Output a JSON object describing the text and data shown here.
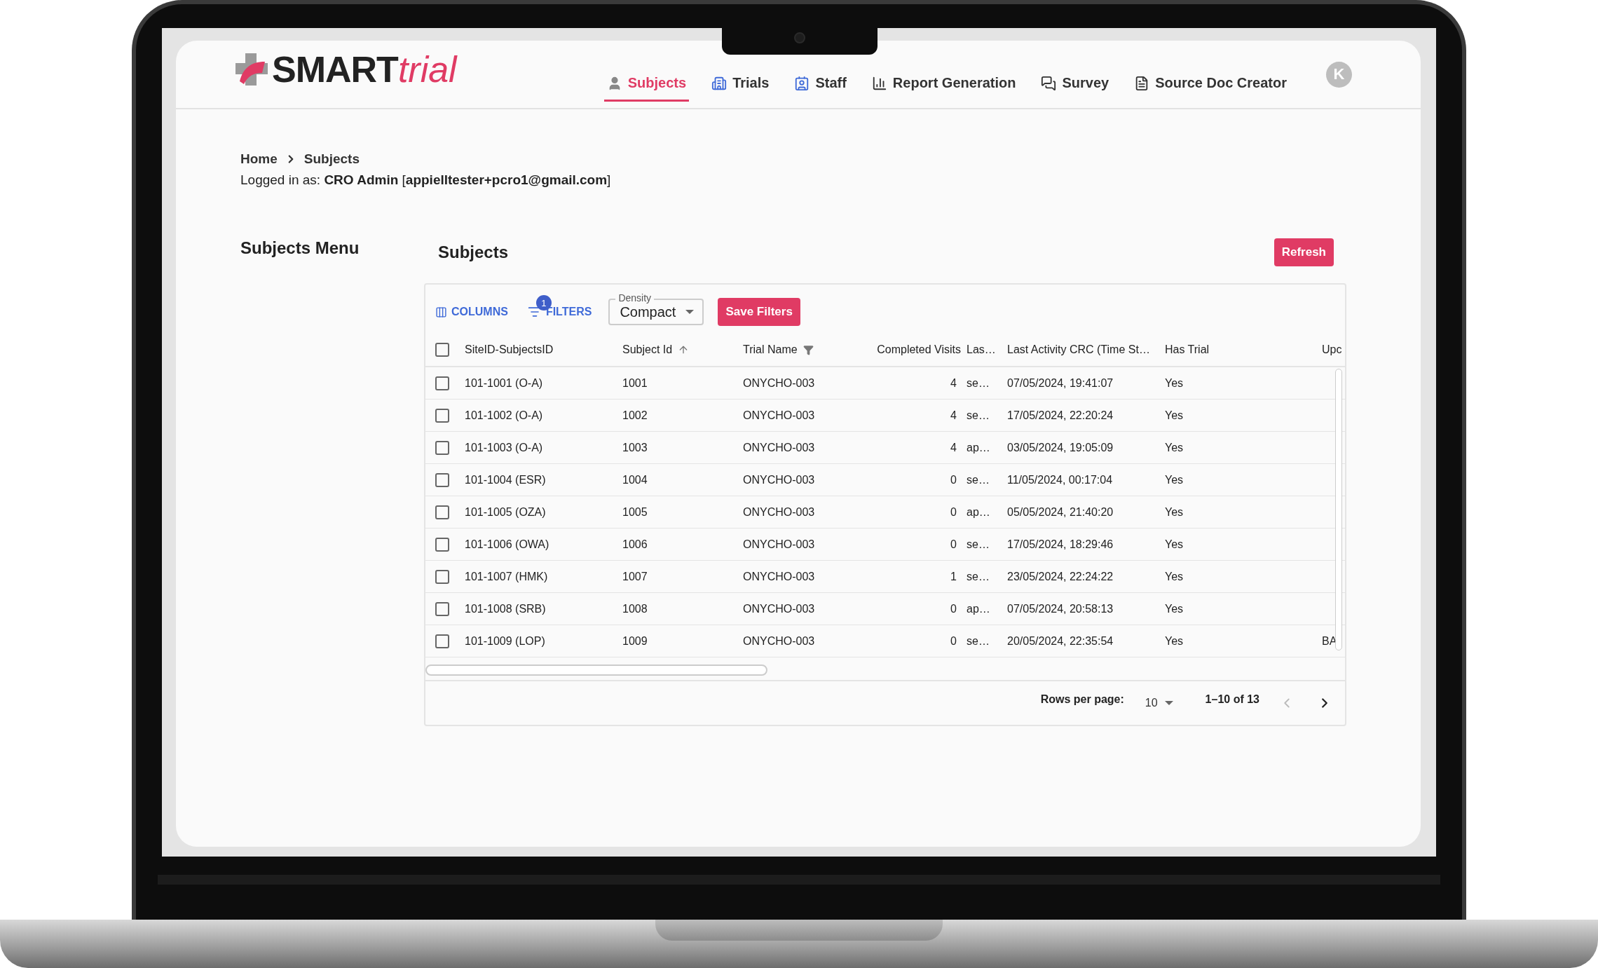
{
  "logo": {
    "brand": "SMART",
    "suffix": "trial"
  },
  "nav": [
    {
      "label": "Subjects",
      "selected": true
    },
    {
      "label": "Trials",
      "selected": false
    },
    {
      "label": "Staff",
      "selected": false
    },
    {
      "label": "Report Generation",
      "selected": false
    },
    {
      "label": "Survey",
      "selected": false
    },
    {
      "label": "Source Doc Creator",
      "selected": false
    }
  ],
  "avatar": "K",
  "breadcrumb": [
    "Home",
    "Subjects"
  ],
  "login": "Logged in as: **CRO Admin** [**appielltester+pcro1@gmail.com**]",
  "sidebar": {
    "title": "Subjects Menu"
  },
  "title": "Subjects",
  "refresh": "Refresh",
  "toolbar": {
    "columns": "COLUMNS",
    "filters": "FILTERS",
    "filter_count": "1",
    "density_label": "Density",
    "density_value": "Compact",
    "save": "Save Filters"
  },
  "table": {
    "all_checked": false,
    "columns": [
      {
        "label": "SiteID-SubjectsID",
        "kind": "plain"
      },
      {
        "label": "Subject Id",
        "kind": "sorted"
      },
      {
        "label": "Trial Name",
        "kind": "filtered"
      },
      {
        "label": "Completed Visits",
        "kind": "number"
      },
      {
        "label": "Las…",
        "kind": "plain"
      },
      {
        "label": "Last Activity CRC (Time St…",
        "kind": "plain"
      },
      {
        "label": "Has Trial",
        "kind": "plain"
      },
      {
        "label": "Upc",
        "kind": "plain"
      }
    ],
    "rows": [
      {
        "checked": false,
        "cells": [
          "101-1001 (O-A)",
          "1001",
          "ONYCHO-003",
          "4",
          "se…",
          "07/05/2024, 19:41:07",
          "Yes",
          ""
        ]
      },
      {
        "checked": false,
        "cells": [
          "101-1002 (O-A)",
          "1002",
          "ONYCHO-003",
          "4",
          "se…",
          "17/05/2024, 22:20:24",
          "Yes",
          ""
        ]
      },
      {
        "checked": false,
        "cells": [
          "101-1003 (O-A)",
          "1003",
          "ONYCHO-003",
          "4",
          "ap…",
          "03/05/2024, 19:05:09",
          "Yes",
          ""
        ]
      },
      {
        "checked": false,
        "cells": [
          "101-1004 (ESR)",
          "1004",
          "ONYCHO-003",
          "0",
          "se…",
          "11/05/2024, 00:17:04",
          "Yes",
          ""
        ]
      },
      {
        "checked": false,
        "cells": [
          "101-1005 (OZA)",
          "1005",
          "ONYCHO-003",
          "0",
          "ap…",
          "05/05/2024, 21:40:20",
          "Yes",
          ""
        ]
      },
      {
        "checked": false,
        "cells": [
          "101-1006 (OWA)",
          "1006",
          "ONYCHO-003",
          "0",
          "se…",
          "17/05/2024, 18:29:46",
          "Yes",
          ""
        ]
      },
      {
        "checked": false,
        "cells": [
          "101-1007 (HMK)",
          "1007",
          "ONYCHO-003",
          "1",
          "se…",
          "23/05/2024, 22:24:22",
          "Yes",
          ""
        ]
      },
      {
        "checked": false,
        "cells": [
          "101-1008 (SRB)",
          "1008",
          "ONYCHO-003",
          "0",
          "ap…",
          "07/05/2024, 20:58:13",
          "Yes",
          ""
        ]
      },
      {
        "checked": false,
        "cells": [
          "101-1009 (LOP)",
          "1009",
          "ONYCHO-003",
          "0",
          "se…",
          "20/05/2024, 22:35:54",
          "Yes",
          "BA"
        ]
      }
    ]
  },
  "pagination": {
    "rows_label": "Rows per page:",
    "rows_value": "10",
    "range": "1–10 of 13",
    "prev_disabled": true,
    "next_disabled": false
  }
}
